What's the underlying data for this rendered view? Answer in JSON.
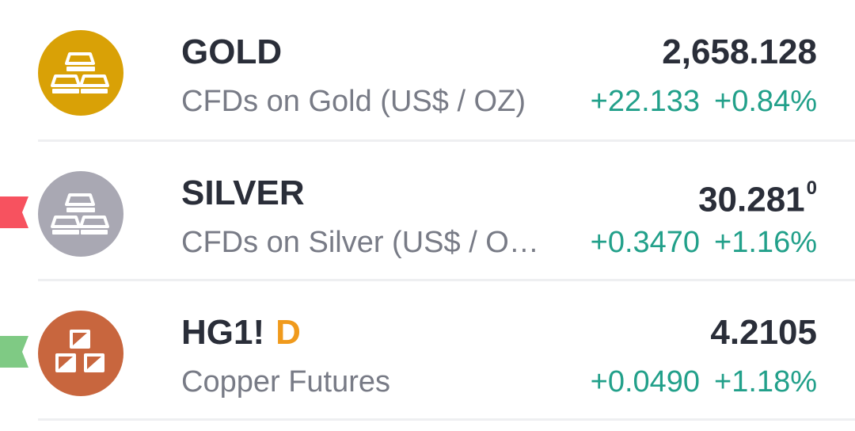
{
  "colors": {
    "gold_icon": "#d9a106",
    "silver_icon": "#a9a8b3",
    "copper_icon": "#c8663e",
    "positive": "#22a08a",
    "symbol_text": "#2a2e39",
    "description_text": "#787b86",
    "badge": "#f09a1c",
    "flag_red": "#f7525f",
    "flag_green": "#7fca84"
  },
  "rows": [
    {
      "symbol": "GOLD",
      "badge": "",
      "description": "CFDs on Gold (US$ / OZ)",
      "price": "2,658.128",
      "price_sup": "",
      "change": "+22.133",
      "change_pct": "+0.84%",
      "icon": "gold-bars-icon",
      "flag": ""
    },
    {
      "symbol": "SILVER",
      "badge": "",
      "description": "CFDs on Silver (US$ / O…",
      "price": "30.281",
      "price_sup": "0",
      "change": "+0.3470",
      "change_pct": "+1.16%",
      "icon": "silver-bars-icon",
      "flag": "red"
    },
    {
      "symbol": "HG1!",
      "badge": "D",
      "description": "Copper Futures",
      "price": "4.2105",
      "price_sup": "",
      "change": "+0.0490",
      "change_pct": "+1.18%",
      "icon": "copper-blocks-icon",
      "flag": "green"
    }
  ]
}
